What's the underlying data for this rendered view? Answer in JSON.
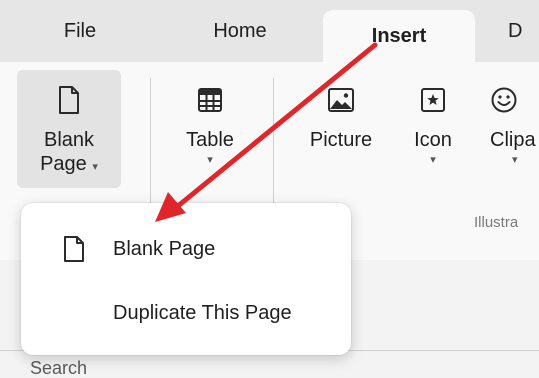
{
  "tabs": {
    "file": "File",
    "home": "Home",
    "insert": "Insert",
    "next_partial": "D"
  },
  "ribbon": {
    "blank_page": {
      "line1": "Blank",
      "line2": "Page",
      "caret": "▾",
      "icon": "blank-page-icon"
    },
    "table": {
      "label": "Table",
      "caret": "▾",
      "icon": "table-icon"
    },
    "picture": {
      "label": "Picture",
      "icon": "picture-icon"
    },
    "icon_btn": {
      "label": "Icon",
      "caret": "▾",
      "icon": "star-in-box-icon"
    },
    "clipart": {
      "label": "Clipa",
      "caret": "▾",
      "icon": "smiley-icon"
    },
    "group_label": "Illustra"
  },
  "menu": {
    "items": [
      {
        "label": "Blank Page",
        "icon": "blank-page-icon"
      },
      {
        "label": "Duplicate This Page"
      }
    ]
  },
  "search": {
    "label": "Search"
  },
  "colors": {
    "annotation_arrow": "#e0262b",
    "ribbon_background": "#f9f9f9",
    "tab_strip_background": "#e6e6e6"
  }
}
